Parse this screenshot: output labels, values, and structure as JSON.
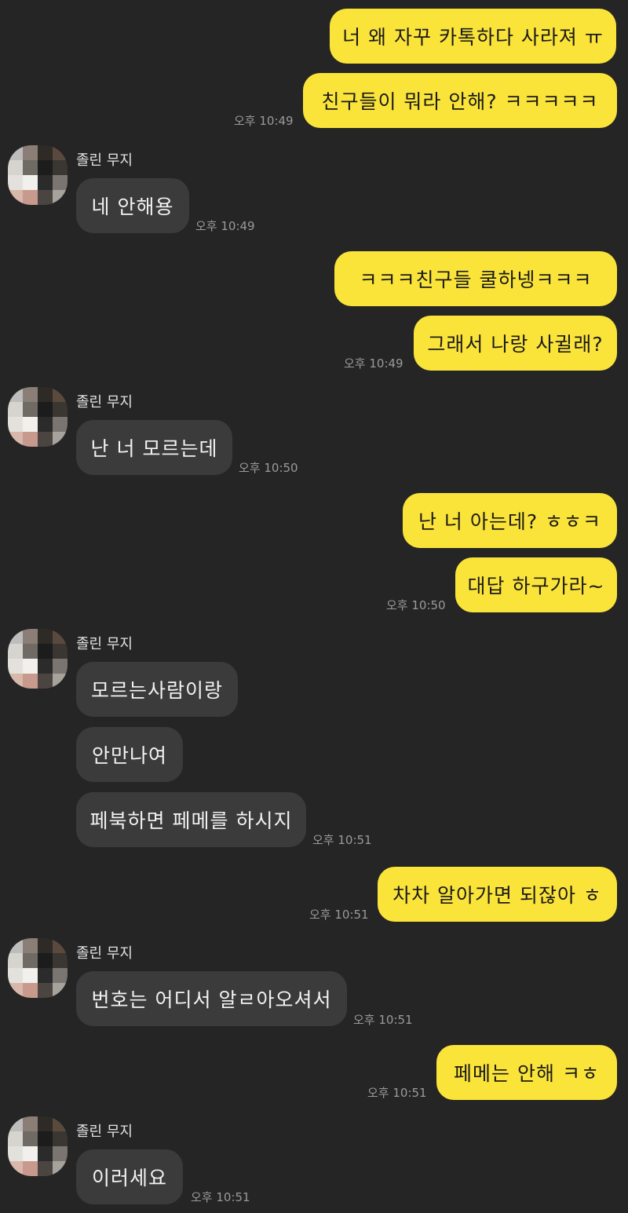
{
  "sender_name": "졸린 무지",
  "messages": {
    "m1": "너 왜 자꾸 카톡하다 사라져 ㅠ",
    "m2": "친구들이 뭐라 안해? ㅋㅋㅋㅋㅋ",
    "m3": "네 안해용",
    "m4": "ㅋㅋㅋ친구들 쿨하넹ㅋㅋㅋ",
    "m5": "그래서 나랑 사귈래?",
    "m6": "난 너 모르는데",
    "m7": "난 너 아는데? ㅎㅎㅋ",
    "m8": "대답 하구가라~",
    "m9": "모르는사람이랑",
    "m10": "안만나여",
    "m11": "페북하면 페메를 하시지",
    "m12": "차차 알아가면 되잖아 ㅎ",
    "m13": "번호는 어디서 알ㄹ아오셔서",
    "m14": "페메는 안해 ㅋㅎ",
    "m15": "이러세요"
  },
  "times": {
    "t1": "오후 10:49",
    "t2": "오후 10:49",
    "t3": "오후 10:49",
    "t4": "오후 10:50",
    "t5": "오후 10:50",
    "t6": "오후 10:51",
    "t7": "오후 10:51",
    "t8": "오후 10:51",
    "t9": "오후 10:51",
    "t10": "오후 10:51"
  },
  "colors": {
    "background": "#252525",
    "outgoing_bubble": "#fbe43a",
    "incoming_bubble": "#3b3b3b"
  }
}
